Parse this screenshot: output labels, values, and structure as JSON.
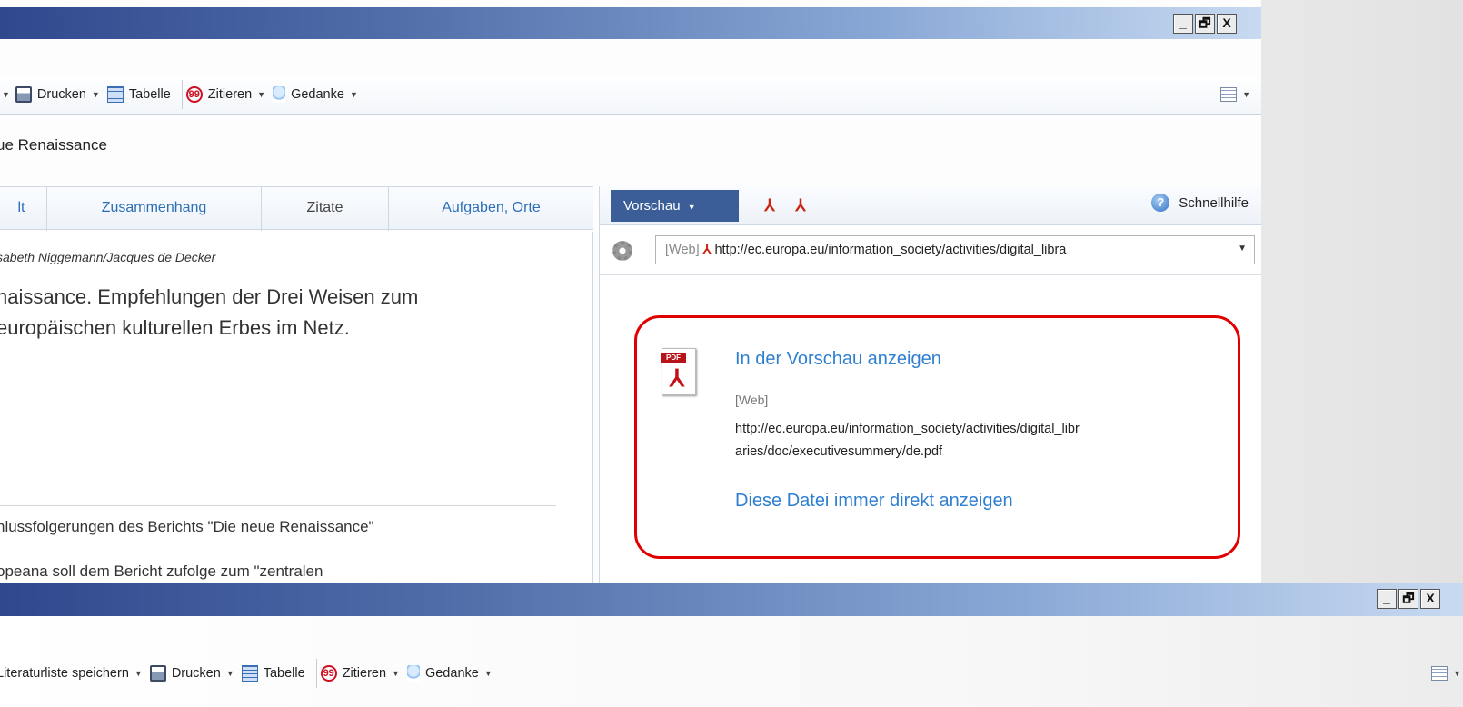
{
  "window_controls": {
    "minimize": "_",
    "restore": "🗗",
    "close": "X"
  },
  "top_window": {
    "toolbar": {
      "print_label": "Drucken",
      "table_label": "Tabelle",
      "cite_label": "Zitieren",
      "thought_label": "Gedanke"
    },
    "breadcrumb": "ue Renaissance",
    "tabs": [
      {
        "label": "lt"
      },
      {
        "label": "Zusammenhang"
      },
      {
        "label": "Zitate"
      },
      {
        "label": "Aufgaben, Orte"
      }
    ],
    "content": {
      "authors": "sabeth Niggemann/Jacques de Decker",
      "title_line1": "naissance. Empfehlungen der Drei Weisen zum",
      "title_line2": "europäischen kulturellen Erbes im Netz.",
      "paragraph1": "hlussfolgerungen des Berichts \"Die neue Renaissance\"",
      "paragraph2": "opeana soll dem Bericht zufolge zum \"zentralen"
    },
    "preview_panel": {
      "dropdown_label": "Vorschau",
      "help_label": "Schnellhilfe",
      "url_web_tag": "[Web]",
      "url_value": "http://ec.europa.eu/information_society/activities/digital_libra",
      "popup": {
        "pdf_label": "PDF",
        "show_preview_link": "In der Vorschau anzeigen",
        "web_tag": "[Web]",
        "url_line1": "http://ec.europa.eu/information_society/activities/digital_libr",
        "url_line2": "aries/doc/executivesummery/de.pdf",
        "always_show_link": "Diese Datei immer direkt anzeigen"
      }
    }
  },
  "bottom_window": {
    "toolbar": {
      "save_list_label": "Literaturliste speichern",
      "print_label": "Drucken",
      "table_label": "Tabelle",
      "cite_label": "Zitieren",
      "thought_label": "Gedanke"
    }
  },
  "colors": {
    "accent_blue": "#3b5e98",
    "link_blue": "#2f7fd1",
    "highlight_red": "#e10000"
  }
}
